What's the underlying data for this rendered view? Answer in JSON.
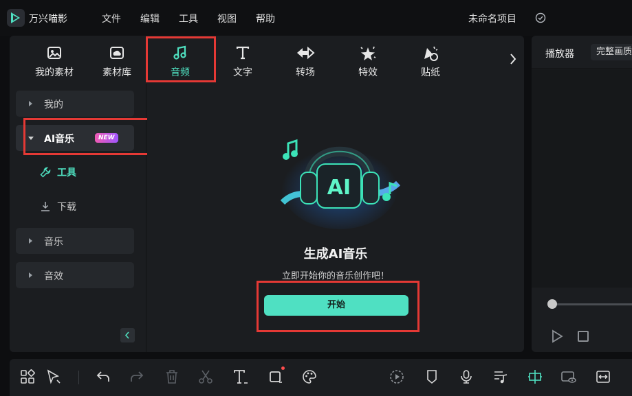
{
  "app": {
    "name": "万兴喵影",
    "menu": [
      "文件",
      "编辑",
      "工具",
      "视图",
      "帮助"
    ],
    "project_name": "未命名项目"
  },
  "toolbar": {
    "tabs": [
      {
        "label": "我的素材",
        "icon": "image-icon"
      },
      {
        "label": "素材库",
        "icon": "cloud-library-icon"
      },
      {
        "label": "音频",
        "icon": "music-note-icon",
        "active": true
      },
      {
        "label": "文字",
        "icon": "text-t-icon"
      },
      {
        "label": "转场",
        "icon": "transition-icon"
      },
      {
        "label": "特效",
        "icon": "sparkle-star-icon"
      },
      {
        "label": "贴纸",
        "icon": "sticker-icon"
      }
    ],
    "more_icon": "chevron-right-icon"
  },
  "sidebar": {
    "items": [
      {
        "label": "我的",
        "expanded": false
      },
      {
        "label": "AI音乐",
        "expanded": true,
        "badge": "NEW"
      },
      {
        "label": "音乐",
        "expanded": false
      },
      {
        "label": "音效",
        "expanded": false
      }
    ],
    "sub_items": [
      {
        "label": "工具",
        "icon": "wrench-icon",
        "active": true
      },
      {
        "label": "下载",
        "icon": "download-icon",
        "active": false
      }
    ]
  },
  "content": {
    "title": "生成AI音乐",
    "subtitle": "立即开始你的音乐创作吧！",
    "button": "开始",
    "hero_text": "AI"
  },
  "player": {
    "tab": "播放器",
    "quality": "完整画质"
  },
  "colors": {
    "accent": "#4fe0c2",
    "highlight_box": "#e53935",
    "panel_bg": "#1b1d20",
    "app_bg": "#0d0e10"
  }
}
